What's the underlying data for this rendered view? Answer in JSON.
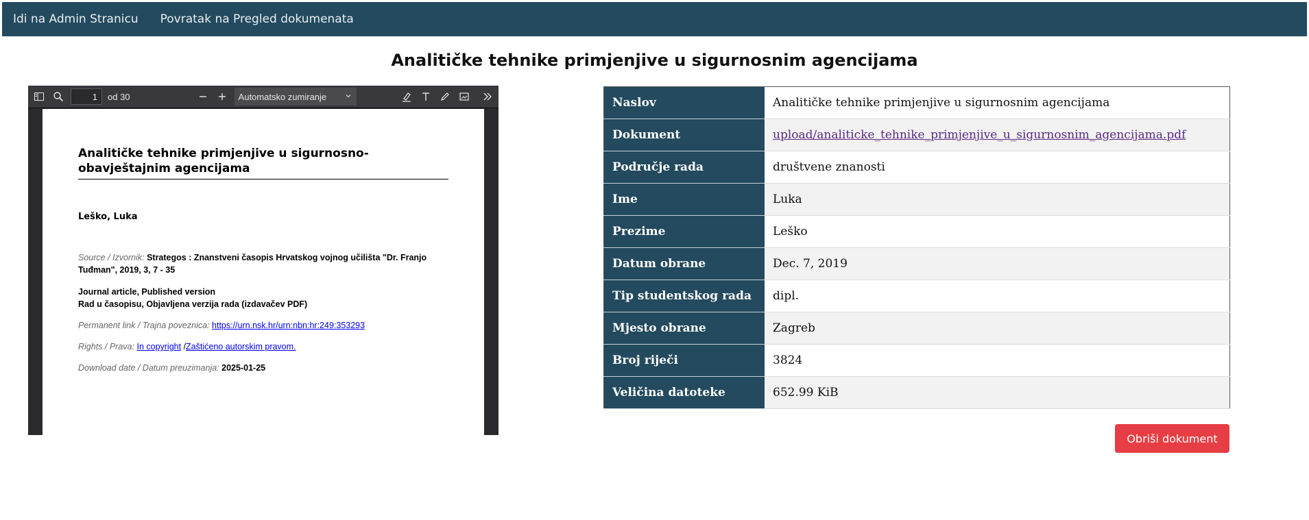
{
  "navbar": {
    "admin_link": "Idi na Admin Stranicu",
    "back_link": "Povratak na Pregled dokumenata"
  },
  "page_title": "Analitičke tehnike primjenjive u sigurnosnim agencijama",
  "pdf_viewer": {
    "page_number": "1",
    "page_count": "od 30",
    "zoom": "Automatsko zumiranje",
    "document": {
      "title": "Analitičke tehnike primjenjive u sigurnosno-obavještajnim agencijama",
      "author": "Leško, Luka",
      "source_label": "Source / Izvornik:",
      "source_value": "Strategos : Znanstveni časopis Hrvatskog vojnog učilišta \"Dr. Franjo Tuđman\", 2019, 3, 7 - 35",
      "type_line1": "Journal article, Published version",
      "type_line2": "Rad u časopisu, Objavljena verzija rada (izdavačev PDF)",
      "permalink_label": "Permanent link / Trajna poveznica:",
      "permalink_value": "https://urn.nsk.hr/urn:nbn:hr:249:353293",
      "rights_label": "Rights / Prava:",
      "rights_link1": "In copyright",
      "rights_sep": " /",
      "rights_link2": "Zaštićeno autorskim pravom.",
      "download_label": "Download date / Datum preuzimanja:",
      "download_value": "2025-01-25"
    }
  },
  "metadata": {
    "rows": [
      {
        "key": "Naslov",
        "value": "Analitičke tehnike primjenjive u sigurnosnim agencijama"
      },
      {
        "key": "Dokument",
        "value": "upload/analiticke_tehnike_primjenjive_u_sigurnosnim_agencijama.pdf"
      },
      {
        "key": "Područje rada",
        "value": "društvene znanosti"
      },
      {
        "key": "Ime",
        "value": "Luka"
      },
      {
        "key": "Prezime",
        "value": "Leško"
      },
      {
        "key": "Datum obrane",
        "value": "Dec. 7, 2019"
      },
      {
        "key": "Tip studentskog rada",
        "value": "dipl."
      },
      {
        "key": "Mjesto obrane",
        "value": "Zagreb"
      },
      {
        "key": "Broj riječi",
        "value": "3824"
      },
      {
        "key": "Veličina datoteke",
        "value": "652.99 KiB"
      }
    ]
  },
  "delete_button": "Obriši dokument",
  "colors": {
    "header": "#234a5e",
    "delete": "#e63e44",
    "link": "#5a2a82"
  }
}
